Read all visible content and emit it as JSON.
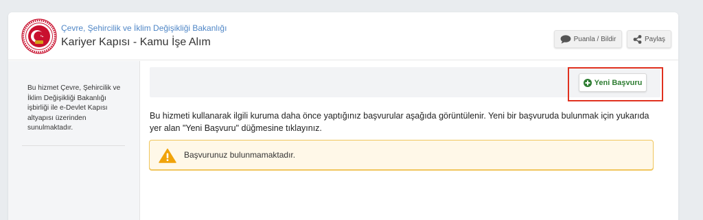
{
  "header": {
    "ministry": "Çevre, Şehircilik ve İklim Değişikliği Bakanlığı",
    "service_title": "Kariyer Kapısı - Kamu İşe Alım",
    "rate_button": "Puanla / Bildir",
    "share_button": "Paylaş"
  },
  "sidebar": {
    "text": "Bu hizmet Çevre, Şehircilik ve İklim Değişikliği Bakanlığı işbirliği ile e-Devlet Kapısı altyapısı üzerinden sunulmaktadır."
  },
  "main": {
    "new_application_button": "Yeni Başvuru",
    "info": "Bu hizmeti kullanarak ilgili kuruma daha önce yaptığınız başvurular aşağıda görüntülenir. Yeni bir başvuruda bulunmak için yukarıda yer alan \"Yeni Başvuru\" düğmesine tıklayınız.",
    "alert": "Başvurunuz bulunmamaktadır."
  },
  "colors": {
    "ministry_link": "#4f86c6",
    "highlight_frame": "#e0301e",
    "button_green": "#2e7d32",
    "alert_border": "#f0c55c",
    "alert_icon": "#f0a30a",
    "logo_red": "#c8102e"
  },
  "icons": {
    "logo": "ministry-emblem",
    "rate": "speech-bubble-icon",
    "share": "share-icon",
    "new": "plus-circle-icon",
    "alert": "warning-triangle-icon"
  }
}
